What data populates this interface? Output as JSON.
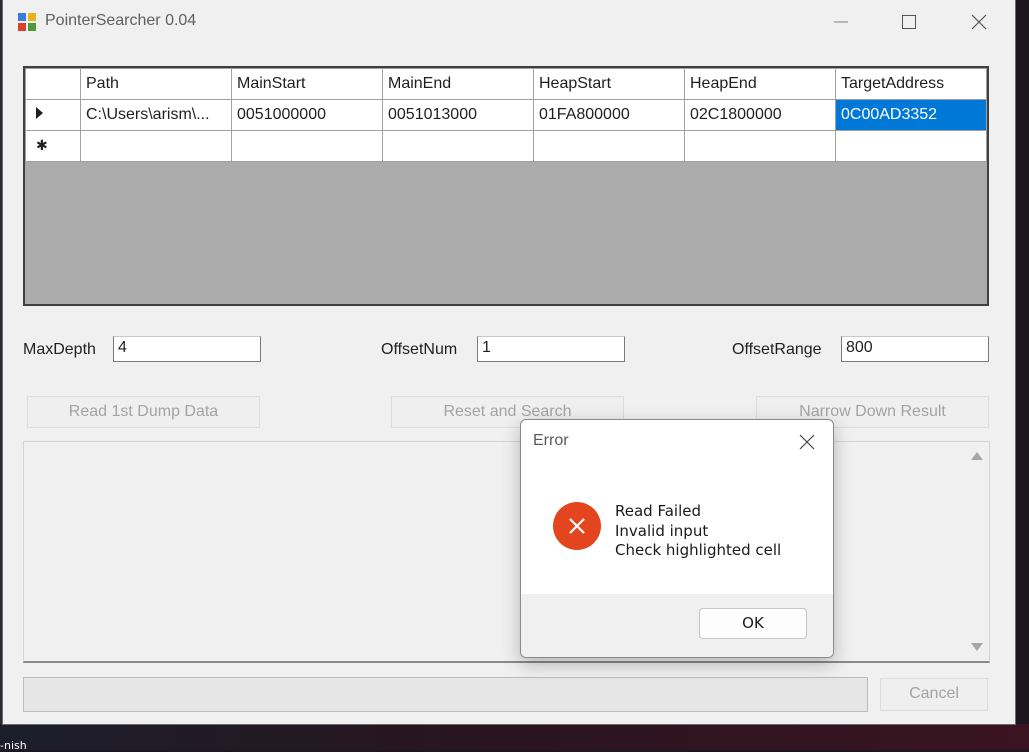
{
  "window": {
    "title": "PointerSearcher 0.04"
  },
  "grid": {
    "columns": [
      "Path",
      "MainStart",
      "MainEnd",
      "HeapStart",
      "HeapEnd",
      "TargetAddress"
    ],
    "rows": [
      [
        "C:\\Users\\arism\\...",
        "0051000000",
        "0051013000",
        "01FA800000",
        "02C1800000",
        "0C00AD3352"
      ]
    ]
  },
  "params": {
    "max_depth_label": "MaxDepth",
    "max_depth_value": "4",
    "offset_num_label": "OffsetNum",
    "offset_num_value": "1",
    "offset_range_label": "OffsetRange",
    "offset_range_value": "800"
  },
  "buttons": {
    "read_dump": "Read 1st Dump Data",
    "reset_search": "Reset and Search",
    "narrow_down": "Narrow Down Result",
    "cancel": "Cancel"
  },
  "dialog": {
    "title": "Error",
    "lines": [
      "Read Failed",
      "Invalid input",
      "Check highlighted cell"
    ],
    "ok": "OK"
  },
  "desktop": {
    "taskbar_text": "-nish"
  },
  "colors": {
    "selection": "#0078d7",
    "error_icon": "#e3461e"
  }
}
